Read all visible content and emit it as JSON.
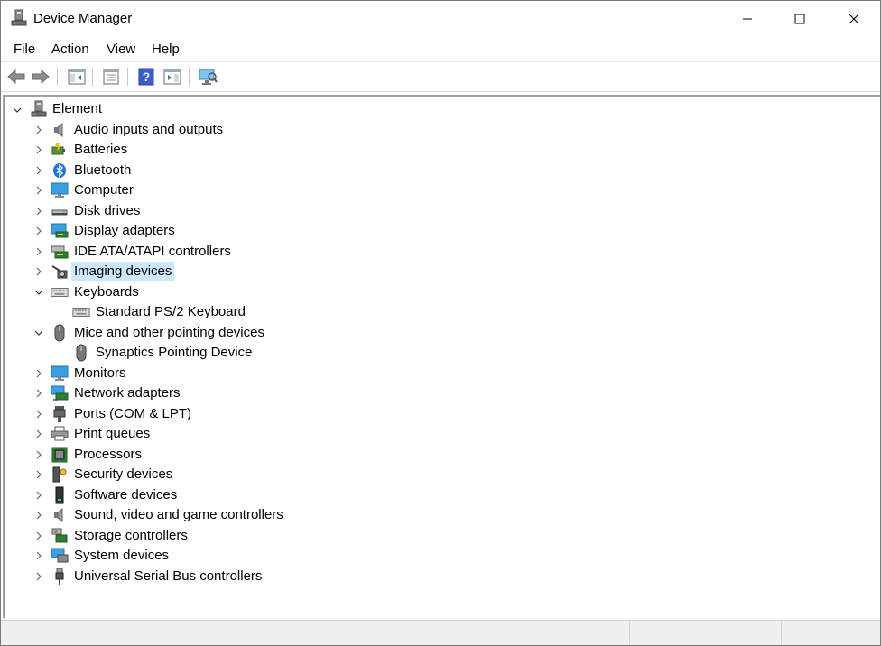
{
  "window": {
    "title": "Device Manager",
    "app_icon": "device-manager-icon"
  },
  "menu": [
    {
      "label": "File"
    },
    {
      "label": "Action"
    },
    {
      "label": "View"
    },
    {
      "label": "Help"
    }
  ],
  "toolbar": [
    {
      "icon": "back-arrow-icon"
    },
    {
      "icon": "forward-arrow-icon"
    },
    {
      "icon": "show-hide-console-tree-icon"
    },
    {
      "icon": "properties-icon"
    },
    {
      "icon": "help-icon"
    },
    {
      "icon": "action-pane-icon"
    },
    {
      "icon": "scan-hardware-changes-icon"
    }
  ],
  "tree": {
    "root": {
      "label": "Element",
      "expanded": true,
      "icon": "computer-tower-icon"
    },
    "categories": [
      {
        "label": "Audio inputs and outputs",
        "icon": "speaker-icon",
        "expanded": false
      },
      {
        "label": "Batteries",
        "icon": "battery-icon",
        "expanded": false
      },
      {
        "label": "Bluetooth",
        "icon": "bluetooth-icon",
        "expanded": false
      },
      {
        "label": "Computer",
        "icon": "monitor-icon",
        "expanded": false
      },
      {
        "label": "Disk drives",
        "icon": "disk-drive-icon",
        "expanded": false
      },
      {
        "label": "Display adapters",
        "icon": "display-adapter-icon",
        "expanded": false
      },
      {
        "label": "IDE ATA/ATAPI controllers",
        "icon": "ide-controller-icon",
        "expanded": false
      },
      {
        "label": "Imaging devices",
        "icon": "camera-icon",
        "expanded": false,
        "selected": true
      },
      {
        "label": "Keyboards",
        "icon": "keyboard-icon",
        "expanded": true,
        "children": [
          {
            "label": "Standard PS/2 Keyboard",
            "icon": "keyboard-icon"
          }
        ]
      },
      {
        "label": "Mice and other pointing devices",
        "icon": "mouse-icon",
        "expanded": true,
        "children": [
          {
            "label": "Synaptics Pointing Device",
            "icon": "mouse-icon"
          }
        ]
      },
      {
        "label": "Monitors",
        "icon": "monitor-icon",
        "expanded": false
      },
      {
        "label": "Network adapters",
        "icon": "network-adapter-icon",
        "expanded": false
      },
      {
        "label": "Ports (COM & LPT)",
        "icon": "port-icon",
        "expanded": false
      },
      {
        "label": "Print queues",
        "icon": "printer-icon",
        "expanded": false
      },
      {
        "label": "Processors",
        "icon": "processor-icon",
        "expanded": false
      },
      {
        "label": "Security devices",
        "icon": "security-key-icon",
        "expanded": false
      },
      {
        "label": "Software devices",
        "icon": "software-device-icon",
        "expanded": false
      },
      {
        "label": "Sound, video and game controllers",
        "icon": "speaker-icon",
        "expanded": false
      },
      {
        "label": "Storage controllers",
        "icon": "storage-controller-icon",
        "expanded": false
      },
      {
        "label": "System devices",
        "icon": "system-device-icon",
        "expanded": false
      },
      {
        "label": "Universal Serial Bus controllers",
        "icon": "usb-icon",
        "expanded": false
      }
    ]
  },
  "colors": {
    "selection": "#cce8ff",
    "accent": "#1e90ff"
  }
}
